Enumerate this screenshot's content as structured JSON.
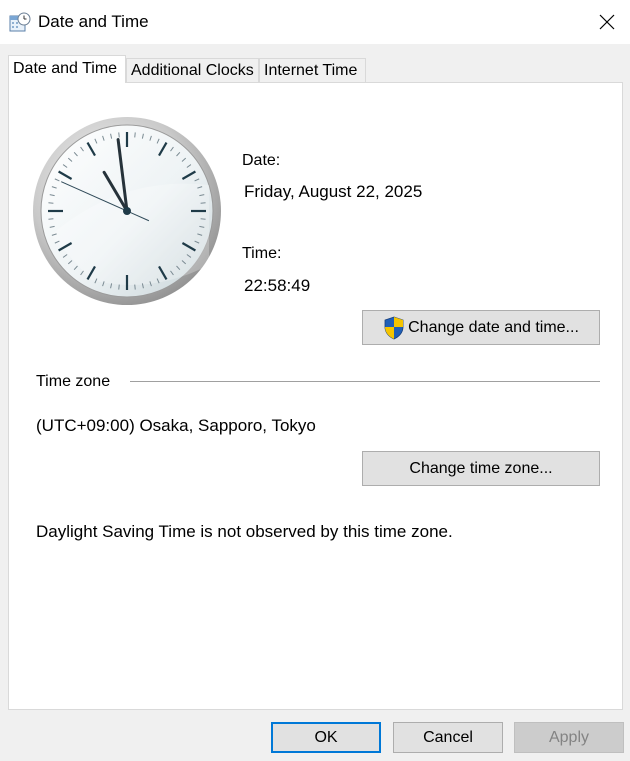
{
  "window": {
    "title": "Date and Time",
    "icon": "calendar-clock-icon",
    "close_icon": "close-icon"
  },
  "tabs": [
    {
      "label": "Date and Time",
      "active": true
    },
    {
      "label": "Additional Clocks",
      "active": false
    },
    {
      "label": "Internet Time",
      "active": false
    }
  ],
  "clock": {
    "hours": 22,
    "minutes": 58,
    "seconds": 49
  },
  "date": {
    "label": "Date:",
    "value": "Friday, August 22, 2025"
  },
  "time": {
    "label": "Time:",
    "value": "22:58:49"
  },
  "change_datetime_button": {
    "label": "Change date and time...",
    "icon": "uac-shield-icon"
  },
  "timezone": {
    "section_label": "Time zone",
    "value": "(UTC+09:00) Osaka, Sapporo, Tokyo",
    "change_button": "Change time zone...",
    "dst_note": "Daylight Saving Time is not observed by this time zone."
  },
  "footer": {
    "ok": "OK",
    "cancel": "Cancel",
    "apply": "Apply"
  },
  "colors": {
    "accent": "#0078d7",
    "panel_bg": "#ffffff",
    "window_bg": "#f0f0f0"
  }
}
